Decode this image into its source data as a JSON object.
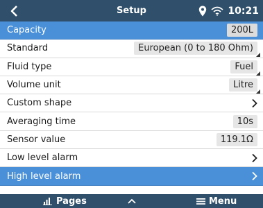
{
  "header": {
    "title": "Setup",
    "time": "10:21",
    "back_icon": "chevron-left-icon",
    "location_icon": "location-pin-icon",
    "wifi_icon": "wifi-icon"
  },
  "settings": [
    {
      "label": "Capacity",
      "value": "200L",
      "selected": true
    },
    {
      "label": "Standard",
      "value": "European (0 to 180 Ohm)"
    },
    {
      "label": "Fluid type",
      "value": "Fuel"
    },
    {
      "label": "Volume unit",
      "value": "Litre"
    },
    {
      "label": "Custom shape"
    },
    {
      "label": "Averaging time",
      "value": "10s"
    },
    {
      "label": "Sensor value",
      "value": "119.1Ω"
    },
    {
      "label": "Low level alarm"
    },
    {
      "label": "High level alarm",
      "highlighted": true
    }
  ],
  "footer": {
    "pages_label": "Pages",
    "menu_label": "Menu",
    "pages_icon": "bar-chart-icon",
    "up_icon": "chevron-up-icon",
    "menu_icon": "hamburger-menu-icon"
  },
  "colors": {
    "bar": "#2f4f6b",
    "selection": "#4a90d9",
    "value_box": "#e6e6e6"
  }
}
